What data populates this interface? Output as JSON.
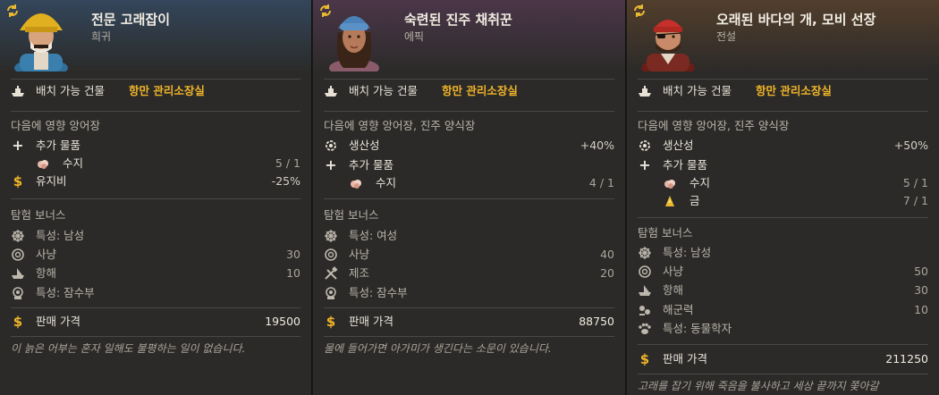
{
  "colors": {
    "card1_header": "#2c3a4a",
    "card2_header": "#463545",
    "card3_header": "#4a3a2c",
    "accent_gold": "#f0b429"
  },
  "cards": [
    {
      "title": "전문 고래잡이",
      "rarity": "희귀",
      "placement_label": "배치 가능 건물",
      "placement_value": "항만 관리소장실",
      "affects": "다음에 영향 앙어장",
      "stats": [
        {
          "icon": "plus-icon",
          "label": "추가 물품",
          "value": ""
        },
        {
          "icon": "resin-icon",
          "label": "수지",
          "value": "5 / 1",
          "sub": true
        },
        {
          "icon": "dollar-icon",
          "label": "유지비",
          "value": "-25%"
        }
      ],
      "expedition_title": "탐험 보너스",
      "bonuses": [
        {
          "icon": "wheel-icon",
          "label": "특성:  남성",
          "value": ""
        },
        {
          "icon": "crosshair-icon",
          "label": "사냥",
          "value": "30"
        },
        {
          "icon": "ship-icon",
          "label": "항해",
          "value": "10"
        },
        {
          "icon": "diver-icon",
          "label": "특성:  잠수부",
          "value": ""
        }
      ],
      "price_label": "판매 가격",
      "price": "19500",
      "quote": "이 늙은 어부는 혼자 일해도 불평하는 일이 없습니다."
    },
    {
      "title": "숙련된 진주 채취꾼",
      "rarity": "에픽",
      "placement_label": "배치 가능 건물",
      "placement_value": "항만 관리소장실",
      "affects": "다음에 영향 앙어장, 진주 양식장",
      "stats": [
        {
          "icon": "gear-icon",
          "label": "생산성",
          "value": "+40%"
        },
        {
          "icon": "plus-icon",
          "label": "추가 물품",
          "value": ""
        },
        {
          "icon": "resin-icon",
          "label": "수지",
          "value": "4 / 1",
          "sub": true
        }
      ],
      "expedition_title": "탐험 보너스",
      "bonuses": [
        {
          "icon": "wheel-icon",
          "label": "특성:  여성",
          "value": ""
        },
        {
          "icon": "crosshair-icon",
          "label": "사냥",
          "value": "40"
        },
        {
          "icon": "tools-icon",
          "label": "제조",
          "value": "20"
        },
        {
          "icon": "diver-icon",
          "label": "특성:  잠수부",
          "value": ""
        }
      ],
      "price_label": "판매 가격",
      "price": "88750",
      "quote": "물에 들어가면 아가미가 생긴다는 소문이 있습니다."
    },
    {
      "title": "오래된 바다의 개, 모비 선장",
      "rarity": "전설",
      "placement_label": "배치 가능 건물",
      "placement_value": "항만 관리소장실",
      "affects": "다음에 영향 앙어장, 진주 양식장",
      "stats": [
        {
          "icon": "gear-icon",
          "label": "생산성",
          "value": "+50%"
        },
        {
          "icon": "plus-icon",
          "label": "추가 물품",
          "value": ""
        },
        {
          "icon": "resin-icon",
          "label": "수지",
          "value": "5 / 1",
          "sub": true
        },
        {
          "icon": "gold-icon",
          "label": "금",
          "value": "7 / 1",
          "sub": true
        }
      ],
      "expedition_title": "탐험 보너스",
      "bonuses": [
        {
          "icon": "wheel-icon",
          "label": "특성:  남성",
          "value": ""
        },
        {
          "icon": "crosshair-icon",
          "label": "사냥",
          "value": "50"
        },
        {
          "icon": "ship-icon",
          "label": "항해",
          "value": "30"
        },
        {
          "icon": "navy-icon",
          "label": "해군력",
          "value": "10"
        },
        {
          "icon": "paw-icon",
          "label": "특성:  동물학자",
          "value": ""
        }
      ],
      "price_label": "판매 가격",
      "price": "211250",
      "quote": "고래를 잡기 위해 죽음을 불사하고 세상 끝까지 쫓아갈"
    }
  ]
}
